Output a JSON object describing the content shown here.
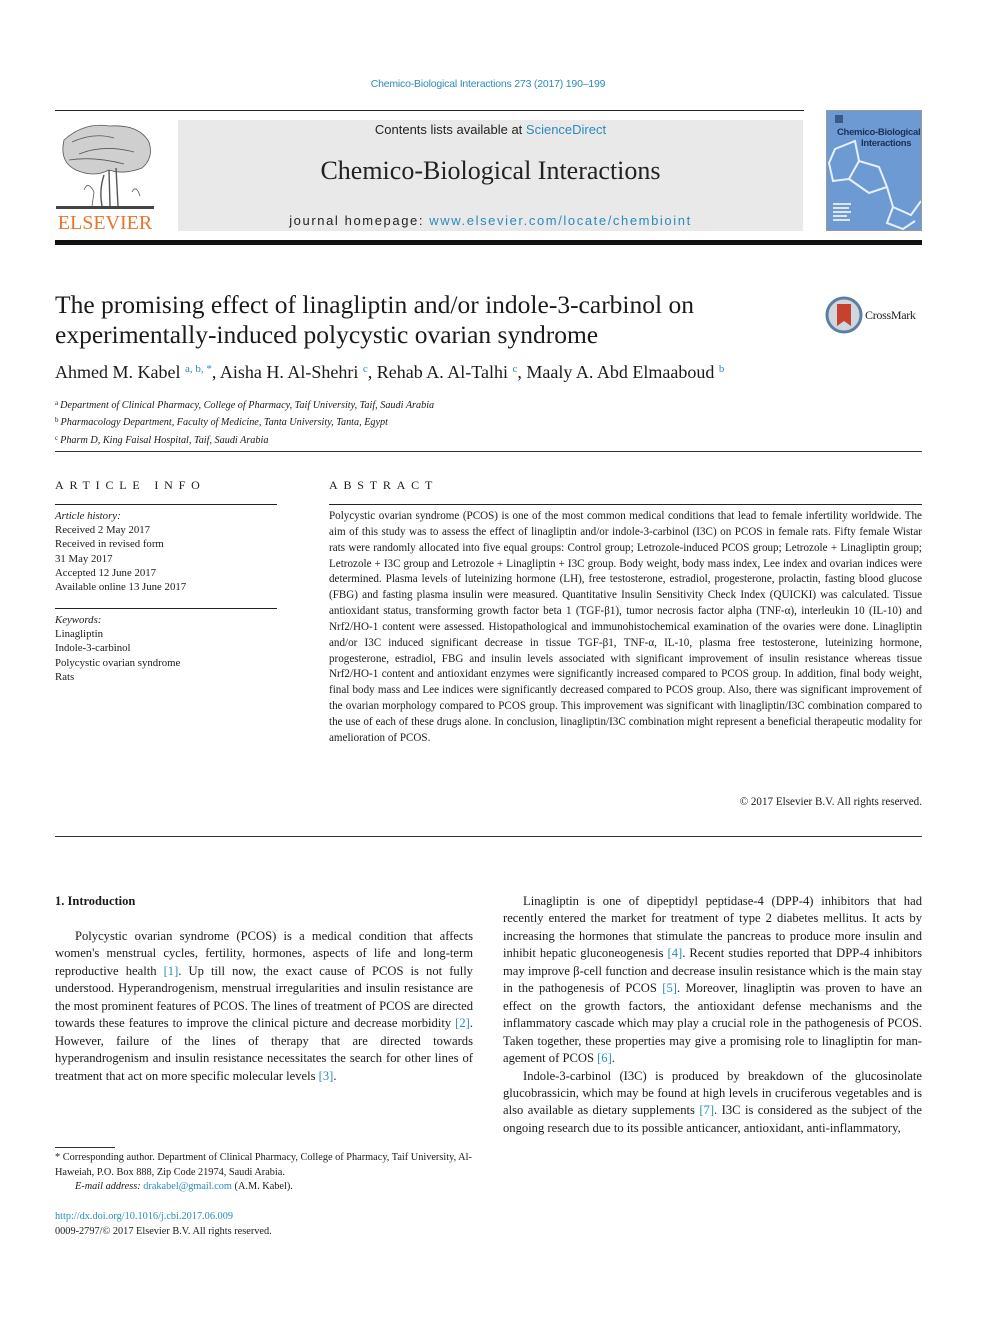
{
  "header": {
    "journal_reference": "Chemico-Biological Interactions 273 (2017) 190–199",
    "contents_prefix": "Contents lists available at ",
    "contents_link": "ScienceDirect",
    "journal_title": "Chemico-Biological Interactions",
    "homepage_prefix": "journal homepage: ",
    "homepage_link": "www.elsevier.com/locate/chembioint",
    "publisher_logo_text": "ELSEVIER",
    "cover_title_line1": "Chemico-Biological",
    "cover_title_line2": "Interactions",
    "brand_color": "#e8752a",
    "link_color": "#2a8bbd"
  },
  "article": {
    "title": "The promising effect of linagliptin and/or indole-3-carbinol on experimentally-induced polycystic ovarian syndrome",
    "crossmark_label": "CrossMark",
    "authors": [
      {
        "name": "Ahmed M. Kabel",
        "sup": "a, b, *"
      },
      {
        "name": "Aisha H. Al-Shehri",
        "sup": "c"
      },
      {
        "name": "Rehab A. Al-Talhi",
        "sup": "c"
      },
      {
        "name": "Maaly A. Abd Elmaaboud",
        "sup": "b"
      }
    ],
    "affiliations": [
      {
        "key": "a",
        "text": "Department of Clinical Pharmacy, College of Pharmacy, Taif University, Taif, Saudi Arabia"
      },
      {
        "key": "b",
        "text": "Pharmacology Department, Faculty of Medicine, Tanta University, Tanta, Egypt"
      },
      {
        "key": "c",
        "text": "Pharm D, King Faisal Hospital, Taif, Saudi Arabia"
      }
    ]
  },
  "article_info": {
    "heading": "ARTICLE INFO",
    "history_label": "Article history:",
    "history": [
      "Received 2 May 2017",
      "Received in revised form",
      "31 May 2017",
      "Accepted 12 June 2017",
      "Available online 13 June 2017"
    ],
    "keywords_label": "Keywords:",
    "keywords": [
      "Linagliptin",
      "Indole-3-carbinol",
      "Polycystic ovarian syndrome",
      "Rats"
    ]
  },
  "abstract": {
    "heading": "ABSTRACT",
    "text": "Polycystic ovarian syndrome (PCOS) is one of the most common medical conditions that lead to female infertility worldwide. The aim of this study was to assess the effect of linagliptin and/or indole-3-carbinol (I3C) on PCOS in female rats. Fifty female Wistar rats were randomly allocated into five equal groups: Control group; Letrozole-induced PCOS group; Letrozole + Linagliptin group; Letrozole + I3C group and Letrozole + Linagliptin + I3C group. Body weight, body mass index, Lee index and ovarian indices were determined. Plasma levels of luteinizing hormone (LH), free testosterone, estradiol, progesterone, pro­lactin, fasting blood glucose (FBG) and fasting plasma insulin were measured. Quantitative Insulin Sensitivity Check Index (QUICKI) was calculated. Tissue antioxidant status, transforming growth factor beta 1 (TGF-β1), tumor necrosis factor alpha (TNF-α), interleukin 10 (IL-10) and Nrf2/HO-1 content were assessed. Histopathological and immunohistochemical examination of the ovaries were done. Linagliptin and/or I3C induced significant decrease in tissue TGF-β1, TNF-α, IL-10, plasma free testosterone, lutei­nizing hormone, progesterone, estradiol, FBG and insulin levels associated with significant improvement of insulin resistance whereas tissue Nrf2/HO-1 content and antioxidant enzymes were significantly increased compared to PCOS group. In addition, final body weight, final body mass and Lee indices were significantly decreased compared to PCOS group. Also, there was significant improvement of the ovarian morphology compared to PCOS group. This improvement was significant with linagliptin/I3C combina­tion compared to the use of each of these drugs alone. In conclusion, linagliptin/I3C combination might represent a beneficial therapeutic modality for amelioration of PCOS.",
    "copyright": "© 2017 Elsevier B.V. All rights reserved."
  },
  "body": {
    "intro_heading": "1.  Introduction",
    "left_paragraph": [
      {
        "t": "Polycystic ovarian syndrome (PCOS) is a medical condition that affects women's menstrual cycles, fertility, hormones, aspects of life and long-term reproductive health "
      },
      {
        "ref": "[1]"
      },
      {
        "t": ". Up till now, the exact cause of PCOS is not fully understood. Hyperandrogenism, men­strual irregularities and insulin resistance are the most prominent features of PCOS. The lines of treatment of PCOS are directed to­wards these features to improve the clinical picture and decrease morbidity "
      },
      {
        "ref": "[2]"
      },
      {
        "t": ". However, failure of the lines of therapy that are directed towards hyperandrogenism and insulin resistance ne­cessitates the search for other lines of treatment that act on more specific molecular levels "
      },
      {
        "ref": "[3]"
      },
      {
        "t": "."
      }
    ],
    "right_paragraph_1": [
      {
        "t": "Linagliptin is one of dipeptidyl peptidase-4 (DPP-4) inhibitors that had recently entered the market for treatment of type 2 dia­betes mellitus. It acts by increasing the hormones that stimulate the pancreas to produce more insulin and inhibit hepatic gluconeo­genesis "
      },
      {
        "ref": "[4]"
      },
      {
        "t": ". Recent studies reported that DPP-4 inhibitors may improve β-cell function and decrease insulin resistance which is the main stay in the pathogenesis of PCOS "
      },
      {
        "ref": "[5]"
      },
      {
        "t": ". Moreover, linagliptin was proven to have an effect on the growth factors, the antioxidant defense mechanisms and the inflammatory cascade which may play a crucial role in the pathogenesis of PCOS. Taken together, these properties may give a promising role to linagliptin for man­agement of PCOS "
      },
      {
        "ref": "[6]"
      },
      {
        "t": "."
      }
    ],
    "right_paragraph_2": [
      {
        "t": "Indole-3-carbinol (I3C) is produced by breakdown of the glu­cosinolate glucobrassicin, which may be found at high levels in cruciferous vegetables and is also available as dietary supplements "
      },
      {
        "ref": "[7]"
      },
      {
        "t": ". I3C is considered as the subject of the ongoing research due to its possible anticancer, antioxidant, anti-inflammatory,"
      }
    ]
  },
  "footnote": {
    "corresponding": "* Corresponding author. Department of Clinical Pharmacy, College of Pharmacy, Taif University, Al-Haweiah, P.O. Box 888, Zip Code 21974, Saudi Arabia.",
    "email_label": "E-mail address:",
    "email": "drakabel@gmail.com",
    "email_suffix": " (A.M. Kabel).",
    "doi": "http://dx.doi.org/10.1016/j.cbi.2017.06.009",
    "issn_line": "0009-2797/© 2017 Elsevier B.V. All rights reserved."
  }
}
